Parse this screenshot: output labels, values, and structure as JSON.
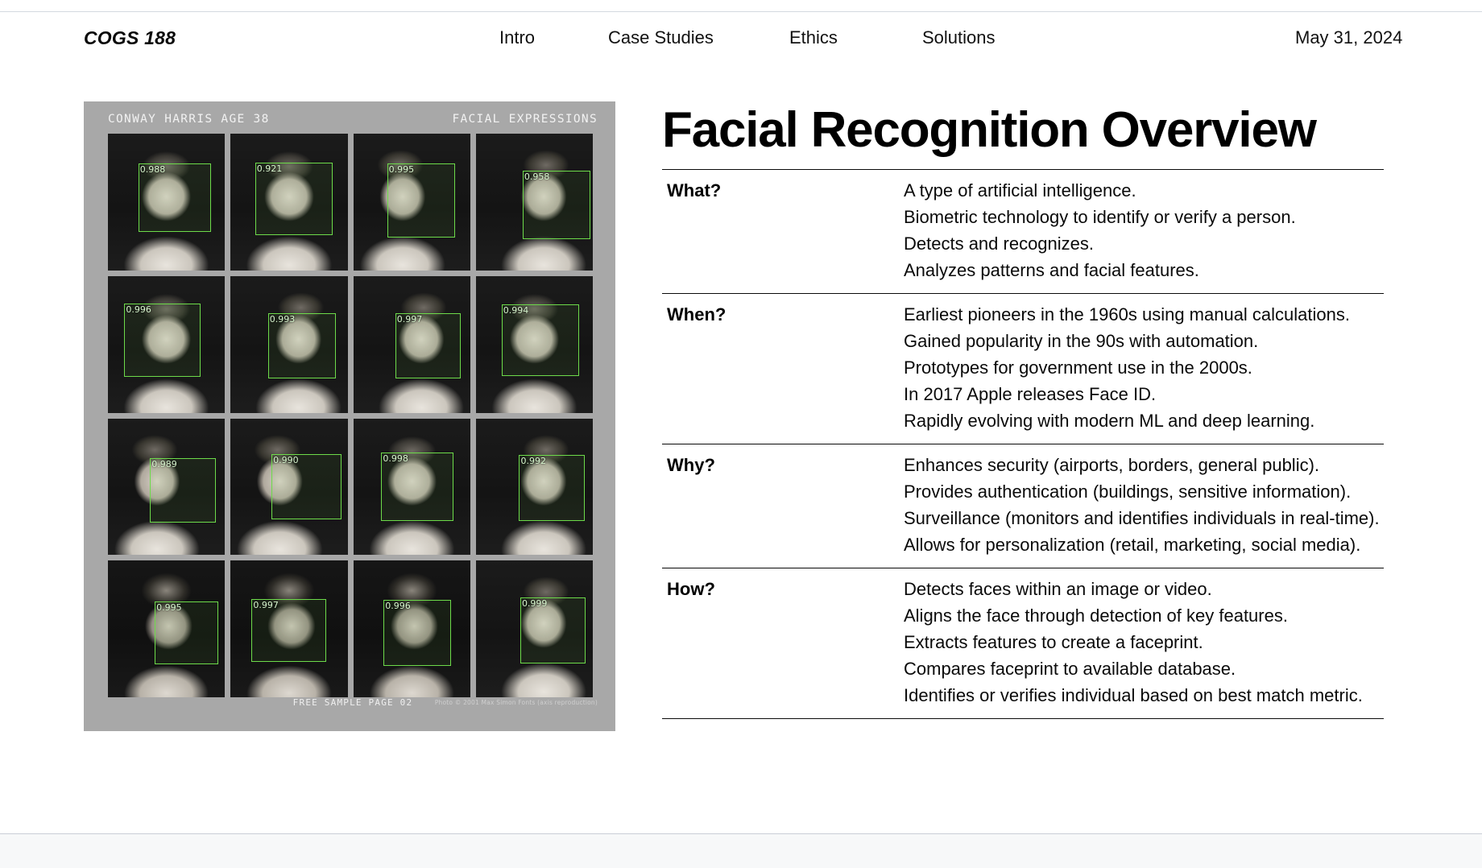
{
  "header": {
    "brand": "COGS 188",
    "nav": [
      {
        "label": "Intro"
      },
      {
        "label": "Case Studies"
      },
      {
        "label": "Ethics"
      },
      {
        "label": "Solutions"
      }
    ],
    "date": "May 31, 2024"
  },
  "figure": {
    "subject_caption": "CONWAY HARRIS  AGE 38",
    "type_caption": "FACIAL EXPRESSIONS",
    "footer_center": "FREE SAMPLE PAGE 02",
    "footer_right": "Photo © 2001 Max Simon Fonts (axis reproduction)",
    "background_color": "#a8a8a8",
    "box_color": "#6ddb4a",
    "rows": 4,
    "columns": 4,
    "detections": [
      {
        "score": "0.988"
      },
      {
        "score": "0.921"
      },
      {
        "score": "0.995"
      },
      {
        "score": "0.958"
      },
      {
        "score": "0.996"
      },
      {
        "score": "0.993"
      },
      {
        "score": "0.997"
      },
      {
        "score": "0.994"
      },
      {
        "score": "0.989"
      },
      {
        "score": "0.990"
      },
      {
        "score": "0.998"
      },
      {
        "score": "0.992"
      },
      {
        "score": "0.995"
      },
      {
        "score": "0.997"
      },
      {
        "score": "0.996"
      },
      {
        "score": "0.999"
      }
    ]
  },
  "main": {
    "title": "Facial Recognition Overview",
    "table": {
      "rows": [
        {
          "question": "What?",
          "answers": [
            "A type of artificial intelligence.",
            "Biometric technology to identify or verify a person.",
            "Detects and recognizes.",
            "Analyzes patterns and facial features."
          ]
        },
        {
          "question": "When?",
          "answers": [
            "Earliest pioneers in the 1960s using manual calculations.",
            "Gained popularity in the 90s with automation.",
            "Prototypes for government use in the 2000s.",
            "In 2017 Apple releases Face ID.",
            "Rapidly evolving with modern ML and deep learning."
          ]
        },
        {
          "question": "Why?",
          "answers": [
            "Enhances security (airports, borders, general public).",
            "Provides authentication (buildings, sensitive information).",
            "Surveillance (monitors and identifies individuals in real-time).",
            "Allows for personalization (retail, marketing, social media)."
          ]
        },
        {
          "question": "How?",
          "answers": [
            "Detects faces within an image or video.",
            "Aligns the face through detection of key features.",
            "Extracts features to create a faceprint.",
            "Compares faceprint to available database.",
            "Identifies or verifies individual based on best match metric."
          ]
        }
      ]
    }
  }
}
